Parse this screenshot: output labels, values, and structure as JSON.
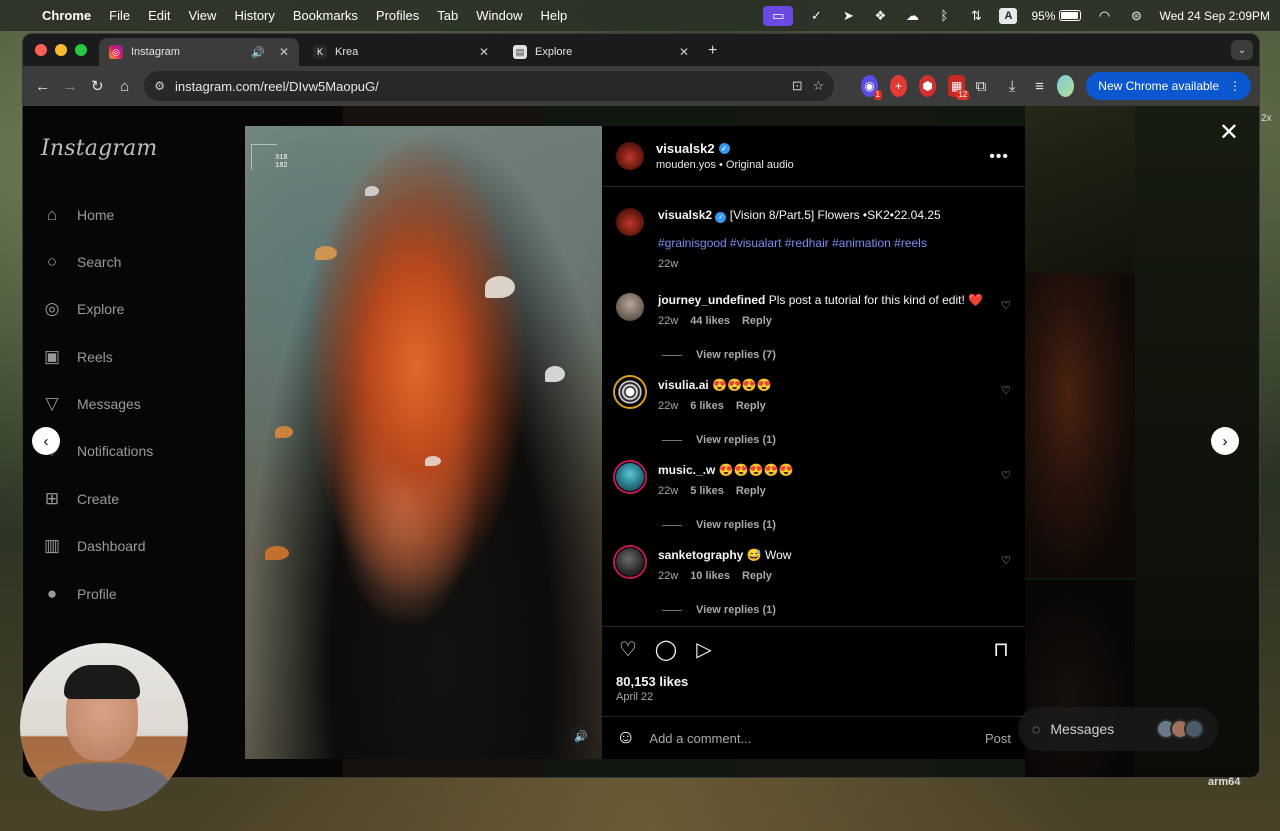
{
  "menubar": {
    "app": "Chrome",
    "items": [
      "File",
      "Edit",
      "View",
      "History",
      "Bookmarks",
      "Profiles",
      "Tab",
      "Window",
      "Help"
    ],
    "battery": "95%",
    "datetime": "Wed 24 Sep  2:09PM",
    "input_badge": "A"
  },
  "tabs": [
    {
      "title": "Instagram",
      "active": true
    },
    {
      "title": "Krea",
      "active": false
    },
    {
      "title": "Explore",
      "active": false
    }
  ],
  "toolbar": {
    "url": "instagram.com/reel/DIvw5MaopuG/",
    "new_chrome": "New Chrome available",
    "ext_badge_1": "1",
    "ext_badge_2": "12"
  },
  "ig": {
    "logo": "Instagram",
    "nav": [
      "Home",
      "Search",
      "Explore",
      "Reels",
      "Messages",
      "Notifications",
      "Create",
      "Dashboard",
      "Profile"
    ]
  },
  "reel": {
    "coord_x": "318",
    "coord_y": "182",
    "username": "visualsk2",
    "audio": "mouden.yos • Original audio",
    "caption_user": "visualsk2",
    "caption": "[Vision 8/Part.5] Flowers •SK2•22.04.25",
    "hashtags": "#grainisgood #visualart #redhair #animation #reels",
    "caption_age": "22w",
    "likes": "80,153 likes",
    "date": "April 22",
    "comment_placeholder": "Add a comment...",
    "post": "Post"
  },
  "comments": [
    {
      "user": "journey_undefined",
      "text": "Pls post a tutorial for this kind of edit! ❤️",
      "age": "22w",
      "likes": "44 likes",
      "reply": "Reply",
      "replies": "View replies (7)"
    },
    {
      "user": "visulia.ai",
      "text": "😍😍😍😍",
      "age": "22w",
      "likes": "6 likes",
      "reply": "Reply",
      "replies": "View replies (1)"
    },
    {
      "user": "music._.w",
      "text": "😍😍😍😍😍",
      "age": "22w",
      "likes": "5 likes",
      "reply": "Reply",
      "replies": "View replies (1)"
    },
    {
      "user": "sanketography",
      "text": "😅 Wow",
      "age": "22w",
      "likes": "10 likes",
      "reply": "Reply",
      "replies": "View replies (1)"
    }
  ],
  "messages_pill": "Messages",
  "overlay_labels": {
    "arch": "arm64",
    "zoom": "2x"
  }
}
